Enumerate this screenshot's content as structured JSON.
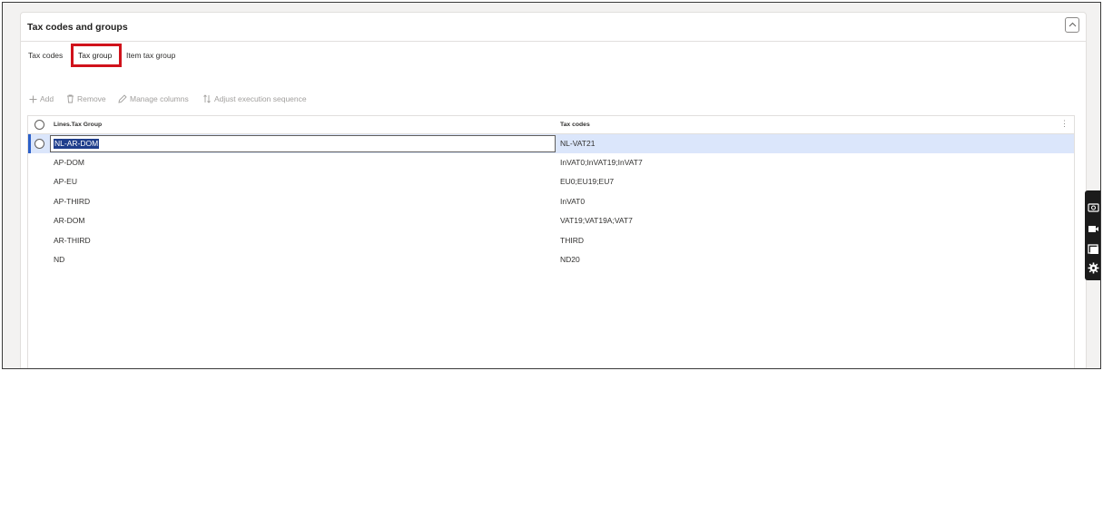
{
  "panel": {
    "title": "Tax codes and groups"
  },
  "tabs": [
    {
      "label": "Tax codes"
    },
    {
      "label": "Tax group"
    },
    {
      "label": "Item tax group"
    }
  ],
  "toolbar": {
    "add_label": "Add",
    "remove_label": "Remove",
    "manage_columns_label": "Manage columns",
    "adjust_sequence_label": "Adjust execution sequence"
  },
  "grid": {
    "columns": [
      "Lines.Tax Group",
      "Tax codes"
    ],
    "rows": [
      {
        "tax_group": "NL-AR-DOM",
        "tax_codes": "NL-VAT21"
      },
      {
        "tax_group": "AP-DOM",
        "tax_codes": "InVAT0;InVAT19;InVAT7"
      },
      {
        "tax_group": "AP-EU",
        "tax_codes": "EU0;EU19;EU7"
      },
      {
        "tax_group": "AP-THIRD",
        "tax_codes": "InVAT0"
      },
      {
        "tax_group": "AR-DOM",
        "tax_codes": "VAT19;VAT19A;VAT7"
      },
      {
        "tax_group": "AR-THIRD",
        "tax_codes": "THIRD"
      },
      {
        "tax_group": "ND",
        "tax_codes": "ND20"
      }
    ]
  },
  "colors": {
    "selected_row": "#dbe6fb",
    "highlight_box": "#d0121b",
    "selection_bar": "#2b5fc8"
  }
}
